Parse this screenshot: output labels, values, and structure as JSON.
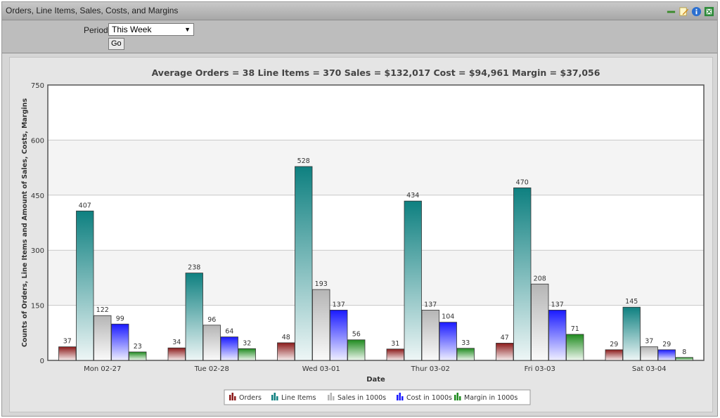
{
  "window": {
    "title": "Orders, Line Items, Sales, Costs, and Margins"
  },
  "toolbar": {
    "icons": [
      "minimize-icon",
      "edit-icon",
      "info-icon",
      "export-excel-icon"
    ]
  },
  "filter": {
    "period_label": "Period:",
    "period_value": "This Week",
    "go_label": "Go"
  },
  "chart_data": {
    "type": "bar",
    "title": "Average Orders = 38 Line Items = 370 Sales = $132,017 Cost = $94,961 Margin = $37,056",
    "xlabel": "Date",
    "ylabel": "Counts of Orders, Line Items and Amount of Sales, Costs, Margins",
    "ylim": [
      0,
      750
    ],
    "yticks": [
      0,
      150,
      300,
      450,
      600,
      750
    ],
    "grid": true,
    "legend_position": "bottom",
    "categories": [
      "Mon 02-27",
      "Tue 02-28",
      "Wed 03-01",
      "Thur 03-02",
      "Fri 03-03",
      "Sat 03-04"
    ],
    "series": [
      {
        "name": "Orders",
        "color": "#8b1a1a",
        "values": [
          37,
          34,
          48,
          31,
          47,
          29
        ]
      },
      {
        "name": "Line Items",
        "color": "#0e8080",
        "values": [
          407,
          238,
          528,
          434,
          470,
          145
        ]
      },
      {
        "name": "Sales in 1000s",
        "color": "#b5b5b5",
        "values": [
          122,
          96,
          193,
          137,
          208,
          37
        ]
      },
      {
        "name": "Cost in 1000s",
        "color": "#1a1aff",
        "values": [
          99,
          64,
          137,
          104,
          137,
          29
        ]
      },
      {
        "name": "Margin in 1000s",
        "color": "#1f8b1f",
        "values": [
          23,
          32,
          56,
          33,
          71,
          8
        ]
      }
    ]
  }
}
